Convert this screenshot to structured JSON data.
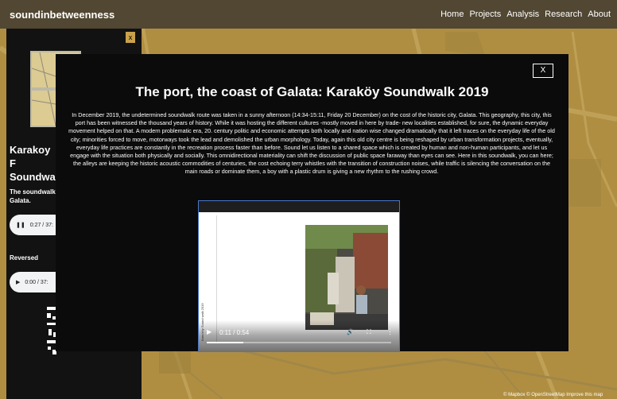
{
  "brand": "soundinbetweenness",
  "nav": [
    {
      "label": "Home"
    },
    {
      "label": "Projects"
    },
    {
      "label": "Analysis"
    },
    {
      "label": "Research"
    },
    {
      "label": "About"
    }
  ],
  "sidebar": {
    "close_label": "x",
    "title": "Karakoy F Soundwa",
    "description": "The soundwalk Galata.",
    "audio1_time": "0:27 / 37:",
    "reversed_label": "Reversed",
    "audio2_time": "0:00 / 37:"
  },
  "modal": {
    "close_label": "X",
    "title": "The port, the coast of Galata: Karaköy Soundwalk 2019",
    "body": "In December 2019, the undetermined soundwalk route was taken in a sunny afternoon (14:34-15:11, Friday 20 December) on the cost of the historic city, Galata. This geography, this city, this port has been witnessed the thousand years of history. While it was hosting the different cultures -mostly moved in here by trade- new localities established, for sure, the dynamic everyday movement helped on that. A modern problematic era, 20. century politic and economic attempts both locally and nation wise changed dramatically that it left traces on the everyday life of the old city; minorities forced to move, motorways took the lead and demolished the urban morphology. Today, again this old city centre is being reshaped by urban transformation projects, eventually, everyday life practices are constantly in the recreation process faster than before. Sound let us listen to a shared space which is created by human and non-human participants, and let us engage with the situation both physically and socially. This omnidirectional materiality can shift the discussion of public space faraway than eyes can see. Here in this soundwalk, you can here; the alleys are keeping the historic acoustic commodities of centuries, the cost echoing terry whistles with the transition of construction noises, while traffic is silencing the conversation on the main roads or dominate them, a boy with a plastic drum is giving a new rhythm to the rushing crowd."
  },
  "video": {
    "time": "0:11 / 0:54",
    "progress": 0.2,
    "side_text": "Kara köy  Sound walk  2019"
  },
  "attribution": "© Mapbox © OpenStreetMap  Improve this map",
  "colors": {
    "map": "#c9a24a",
    "modal": "#0b0b0b",
    "sidebar": "#121212",
    "accent_border": "#4a76c8"
  }
}
